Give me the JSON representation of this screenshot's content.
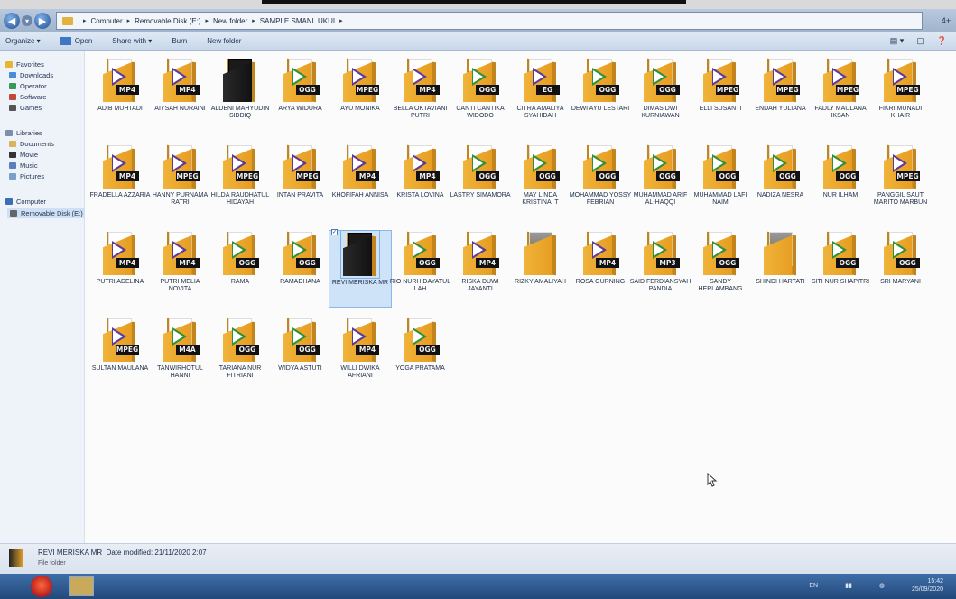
{
  "address": {
    "crumbs": [
      "Computer",
      "Removable Disk (E:)",
      "New folder",
      "SAMPLE SMANL UKUI"
    ],
    "right_label": "4+"
  },
  "toolbar": {
    "organize": "Organize ▾",
    "open": "Open",
    "share": "Share with ▾",
    "burn": "Burn",
    "new_folder": "New folder"
  },
  "nav": {
    "favorites": "Favorites",
    "downloads": "Downloads",
    "operator": "Operator",
    "software": "Software",
    "games": "Games",
    "libraries": "Libraries",
    "documents": "Documents",
    "movie": "Movie",
    "music": "Music",
    "pictures": "Pictures",
    "computer": "Computer",
    "removable": "Removable Disk (E:)"
  },
  "files": [
    {
      "name": "ADIB MUHTADI",
      "badge": "MP4"
    },
    {
      "name": "AIYSAH NURAINI",
      "badge": "MP4"
    },
    {
      "name": "ALDENI MAHYUDIN SIDDIQ",
      "badge": ""
    },
    {
      "name": "ARYA WIDURA",
      "badge": "OGG"
    },
    {
      "name": "AYU MONIKA",
      "badge": "MPEG"
    },
    {
      "name": "BELLA OKTAVIANI PUTRI",
      "badge": "MP4"
    },
    {
      "name": "CANTI CANTIKA WIDODO",
      "badge": "OGG"
    },
    {
      "name": "CITRA AMALIYA SYAHIDAH",
      "badge": "EG"
    },
    {
      "name": "DEWI AYU LESTARI",
      "badge": "OGG"
    },
    {
      "name": "DIMAS DWI KURNIAWAN",
      "badge": "OGG"
    },
    {
      "name": "ELLI SUSANTI",
      "badge": "MPEG"
    },
    {
      "name": "ENDAH YULIANA",
      "badge": "MPEG"
    },
    {
      "name": "FADLY MAULANA IKSAN",
      "badge": "MPEG"
    },
    {
      "name": "FIKRI MUNADI KHAIR",
      "badge": "MPEG"
    },
    {
      "name": "FRADELLA AZZARIA",
      "badge": "MP4"
    },
    {
      "name": "HANNY PURNAMA RATRI",
      "badge": "MPEG"
    },
    {
      "name": "HILDA RAUDHATUL HIDAYAH",
      "badge": "MPEG"
    },
    {
      "name": "INTAN PRAVITA",
      "badge": "MPEG"
    },
    {
      "name": "KHOFIFAH ANNISA",
      "badge": "MP4"
    },
    {
      "name": "KRISTA LOVINA",
      "badge": "MP4"
    },
    {
      "name": "LASTRY SIMAMORA",
      "badge": "OGG"
    },
    {
      "name": "MAY LINDA KRISTINA. T",
      "badge": "OGG"
    },
    {
      "name": "MOHAMMAD YOSSY FEBRIAN",
      "badge": "OGG"
    },
    {
      "name": "MUHAMMAD ARIF AL-HAQQI",
      "badge": "OGG"
    },
    {
      "name": "MUHAMMAD LAFI NAIM",
      "badge": "OGG"
    },
    {
      "name": "NADIZA NESRA",
      "badge": "OGG"
    },
    {
      "name": "NUR ILHAM",
      "badge": "OGG"
    },
    {
      "name": "PANGGIL SAUT MARITO MARBUN",
      "badge": "MPEG"
    },
    {
      "name": "PUTRI ADELINA",
      "badge": "MP4"
    },
    {
      "name": "PUTRI MELIA NOVITA",
      "badge": "MP4"
    },
    {
      "name": "RAMA",
      "badge": "OGG"
    },
    {
      "name": "RAMADHANA",
      "badge": "OGG"
    },
    {
      "name": "REVI MERISKA MR",
      "badge": ""
    },
    {
      "name": "RIO NURHIDAYATUL LAH",
      "badge": "OGG"
    },
    {
      "name": "RISKA DUWI JAYANTI",
      "badge": "MP4"
    },
    {
      "name": "RIZKY AMALIYAH",
      "badge": ""
    },
    {
      "name": "ROSA GURNING",
      "badge": "MP4"
    },
    {
      "name": "SAID FERDIANSYAH PANDIA",
      "badge": "MP3"
    },
    {
      "name": "SANDY HERLAMBANG",
      "badge": "OGG"
    },
    {
      "name": "SHINDI HARTATI",
      "badge": ""
    },
    {
      "name": "SITI NUR SHAPITRI",
      "badge": "OGG"
    },
    {
      "name": "SRI MARYANI",
      "badge": "OGG"
    },
    {
      "name": "SULTAN MAULANA",
      "badge": "MPEG"
    },
    {
      "name": "TANWIRHOTUL HANNI",
      "badge": "M4A"
    },
    {
      "name": "TARIANA NUR FITRIANI",
      "badge": "OGG"
    },
    {
      "name": "WIDYA ASTUTI",
      "badge": "OGG"
    },
    {
      "name": "WILLI DWIKA AFRIANI",
      "badge": "MP4"
    },
    {
      "name": "YOGA PRATAMA",
      "badge": "OGG"
    }
  ],
  "details": {
    "name": "REVI MERISKA MR",
    "modified": "Date modified: 21/11/2020 2:07",
    "type": "File folder"
  },
  "taskbar": {
    "lang": "EN",
    "time": "15:42",
    "date": "25/09/2020"
  },
  "colors": {
    "folder": "#e9a52a",
    "play_purple": "#5b3b9a",
    "play_green": "#2f8f3a",
    "selection": "#cfe3f8"
  }
}
